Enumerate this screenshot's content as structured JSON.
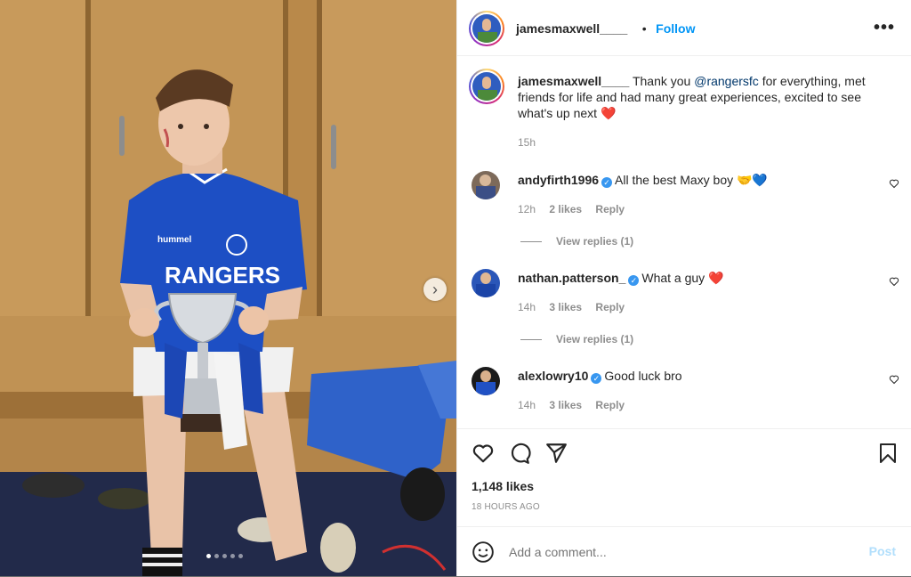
{
  "post": {
    "username": "jamesmaxwell____",
    "follow_label": "Follow",
    "separator": "•",
    "more_label": "•••"
  },
  "caption": {
    "username": "jamesmaxwell____",
    "text_before": "Thank you ",
    "mention": "@rangersfc",
    "text_after": " for everything, met friends for life and had many great experiences, excited to see what's up next ❤️",
    "time": "15h"
  },
  "comments": [
    {
      "username": "andyfirth1996",
      "verified": true,
      "text": "All the best Maxy boy 🤝💙",
      "time": "12h",
      "likes": "2 likes",
      "reply": "Reply",
      "view_replies": "View replies (1)"
    },
    {
      "username": "nathan.patterson_",
      "verified": true,
      "text": "What a guy ❤️",
      "time": "14h",
      "likes": "3 likes",
      "reply": "Reply",
      "view_replies": "View replies (1)"
    },
    {
      "username": "alexlowry10",
      "verified": true,
      "text": "Good luck bro",
      "time": "14h",
      "likes": "3 likes",
      "reply": "Reply"
    }
  ],
  "likes_count": "1,148 likes",
  "posted_ago": "18 HOURS AGO",
  "comment_input": {
    "placeholder": "Add a comment...",
    "post_label": "Post"
  },
  "photo": {
    "shirt_text": "RANGERS",
    "brand_text": "hummel",
    "next_icon": "›",
    "carousel_dots": 5,
    "active_dot": 1
  },
  "colors": {
    "link": "#0095f6",
    "mention": "#00376b",
    "shirt": "#1d4fc4",
    "post_disabled": "#b2dffc"
  }
}
